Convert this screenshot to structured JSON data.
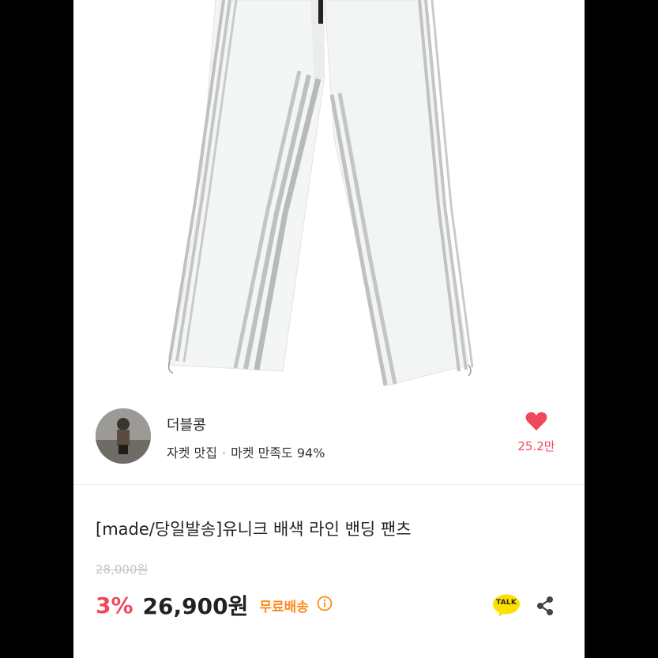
{
  "seller": {
    "name": "더블콩",
    "tagline": "자켓 맛집",
    "separator": "·",
    "satisfaction": "마켓 만족도 94%"
  },
  "likes": {
    "count": "25.2만"
  },
  "product": {
    "title": "[made/당일발송]유니크 배색 라인 밴딩 팬츠",
    "original_price": "28,000원",
    "discount": "3%",
    "price": "26,900원",
    "shipping": "무료배송"
  },
  "actions": {
    "kakao_label": "TALK"
  },
  "colors": {
    "accent_red": "#ef4a5c",
    "free_shipping": "#ff8a1f",
    "kakao_yellow": "#fae100"
  },
  "icons": [
    "heart-icon",
    "info-icon",
    "kakao-talk-icon",
    "share-icon"
  ]
}
